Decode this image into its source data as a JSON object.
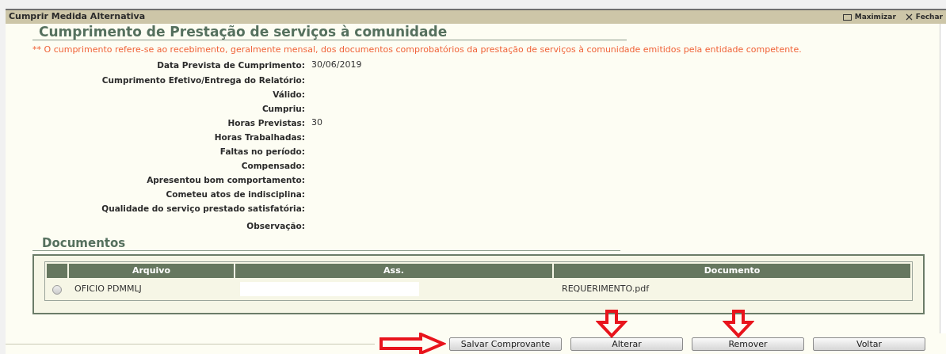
{
  "window": {
    "title": "Cumprir Medida Alternativa",
    "actions": [
      {
        "kind": "maximize",
        "label": "Maximizar"
      },
      {
        "kind": "close",
        "label": "Fechar"
      }
    ]
  },
  "heading": "Cumprimento de Prestação de serviços à comunidade",
  "note": "** O cumprimento refere-se ao recebimento, geralmente mensal, dos documentos comprobatórios da prestação de serviços à comunidade emitidos pela entidade competente.",
  "fields": [
    {
      "label": "Data Prevista de Cumprimento:",
      "value": "30/06/2019"
    },
    {
      "label": "Cumprimento Efetivo/Entrega do Relatório:"
    },
    {
      "label": "Válido:"
    },
    {
      "label": "Cumpriu:"
    },
    {
      "label": "Horas Previstas:",
      "value": "30"
    },
    {
      "label": "Horas Trabalhadas:"
    },
    {
      "label": "Faltas no período:"
    },
    {
      "label": "Compensado:"
    },
    {
      "label": "Apresentou bom comportamento:"
    },
    {
      "label": "Cometeu atos de indisciplina:"
    },
    {
      "label": "Qualidade do serviço prestado satisfatória:"
    },
    {
      "label": "Observação:"
    }
  ],
  "documents": {
    "title": "Documentos",
    "columns": [
      "Arquivo",
      "Ass.",
      "Documento"
    ],
    "rows": [
      {
        "selected": false,
        "arquivo": "OFICIO PDMMLJ",
        "documento": "REQUERIMENTO.pdf"
      }
    ]
  },
  "buttons": [
    "Salvar Comprovante",
    "Alterar",
    "Remover",
    "Voltar"
  ]
}
